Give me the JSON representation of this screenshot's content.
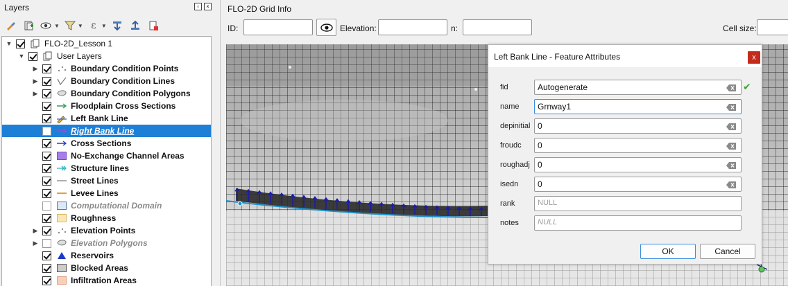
{
  "layers_panel": {
    "title": "Layers",
    "toolbar": [
      "paint-brush-icon",
      "add-group-icon",
      "eye-filter-icon",
      "filter-icon",
      "expression-filter-icon",
      "expand-all-icon",
      "collapse-all-icon",
      "remove-layer-icon"
    ],
    "tree": [
      {
        "label": "FLO-2D_Lesson 1",
        "indent": 0,
        "expanded": true,
        "checked": true,
        "icon": "group-icon",
        "style": "plain"
      },
      {
        "label": "User Layers",
        "indent": 1,
        "expanded": true,
        "checked": true,
        "icon": "group-icon",
        "style": "plain"
      },
      {
        "label": "Boundary Condition Points",
        "indent": 2,
        "expander": true,
        "checked": true,
        "icon": "points-icon",
        "style": "bold"
      },
      {
        "label": "Boundary Condition Lines",
        "indent": 2,
        "expander": true,
        "checked": true,
        "icon": "lines-icon",
        "style": "bold"
      },
      {
        "label": "Boundary Condition Polygons",
        "indent": 2,
        "expander": true,
        "checked": true,
        "icon": "polygons-icon",
        "style": "bold"
      },
      {
        "label": "Floodplain Cross Sections",
        "indent": 2,
        "checked": true,
        "icon": "green-arrow-icon",
        "style": "bold"
      },
      {
        "label": "Left Bank Line",
        "indent": 2,
        "checked": true,
        "icon": "edit-pencil-icon",
        "style": "bold"
      },
      {
        "label": "Right Bank Line",
        "indent": 2,
        "checked": false,
        "icon": "purple-arrow-icon",
        "style": "bold",
        "selected": true
      },
      {
        "label": "Cross Sections",
        "indent": 2,
        "checked": true,
        "icon": "blue-arrow-icon",
        "style": "bold"
      },
      {
        "label": "No-Exchange Channel Areas",
        "indent": 2,
        "checked": true,
        "icon": "purple-square-icon",
        "style": "bold"
      },
      {
        "label": "Structure lines",
        "indent": 2,
        "checked": true,
        "icon": "teal-arrow-icon",
        "style": "bold"
      },
      {
        "label": "Street Lines",
        "indent": 2,
        "checked": true,
        "icon": "gray-line-icon",
        "style": "bold"
      },
      {
        "label": "Levee Lines",
        "indent": 2,
        "checked": true,
        "icon": "orange-line-icon",
        "style": "bold"
      },
      {
        "label": "Computational Domain",
        "indent": 2,
        "checked": false,
        "icon": "light-blue-square-icon",
        "style": "muted"
      },
      {
        "label": "Roughness",
        "indent": 2,
        "checked": true,
        "icon": "yellow-square-icon",
        "style": "bold"
      },
      {
        "label": "Elevation Points",
        "indent": 2,
        "expander": true,
        "checked": true,
        "icon": "points-icon",
        "style": "bold"
      },
      {
        "label": "Elevation Polygons",
        "indent": 2,
        "expander": true,
        "checked": false,
        "icon": "polygons-icon",
        "style": "muted"
      },
      {
        "label": "Reservoirs",
        "indent": 2,
        "checked": true,
        "icon": "blue-triangle-icon",
        "style": "bold"
      },
      {
        "label": "Blocked Areas",
        "indent": 2,
        "checked": true,
        "icon": "gray-square-icon",
        "style": "bold"
      },
      {
        "label": "Infiltration Areas",
        "indent": 2,
        "checked": true,
        "icon": "peach-square-icon",
        "style": "bold"
      }
    ]
  },
  "grid_info": {
    "title": "FLO-2D Grid Info",
    "id_label": "ID:",
    "id_value": "",
    "elevation_label": "Elevation:",
    "elevation_value": "",
    "n_label": "n:",
    "n_value": "",
    "cell_size_label": "Cell size:",
    "cell_size_value": ""
  },
  "dialog": {
    "title": "Left Bank Line - Feature Attributes",
    "close_label": "x",
    "fields": [
      {
        "name": "fid",
        "value": "Autogenerate",
        "state": "value",
        "clear": true,
        "valid": true
      },
      {
        "name": "name",
        "value": "Grnway1",
        "state": "focused",
        "clear": true
      },
      {
        "name": "depinitial",
        "value": "0",
        "state": "value",
        "clear": true
      },
      {
        "name": "froudc",
        "value": "0",
        "state": "value",
        "clear": true
      },
      {
        "name": "roughadj",
        "value": "0",
        "state": "value",
        "clear": true
      },
      {
        "name": "isedn",
        "value": "0",
        "state": "value",
        "clear": true
      },
      {
        "name": "rank",
        "value": "NULL",
        "state": "null",
        "clear": false
      },
      {
        "name": "notes",
        "value": "NULL",
        "state": "null-italic",
        "clear": false
      }
    ],
    "ok_label": "OK",
    "cancel_label": "Cancel"
  },
  "colors": {
    "selection": "#1e7fd6",
    "bank_line": "#1e90c8",
    "cross_section_arrows": "#1a1aa8",
    "close_button": "#c42b1c"
  }
}
